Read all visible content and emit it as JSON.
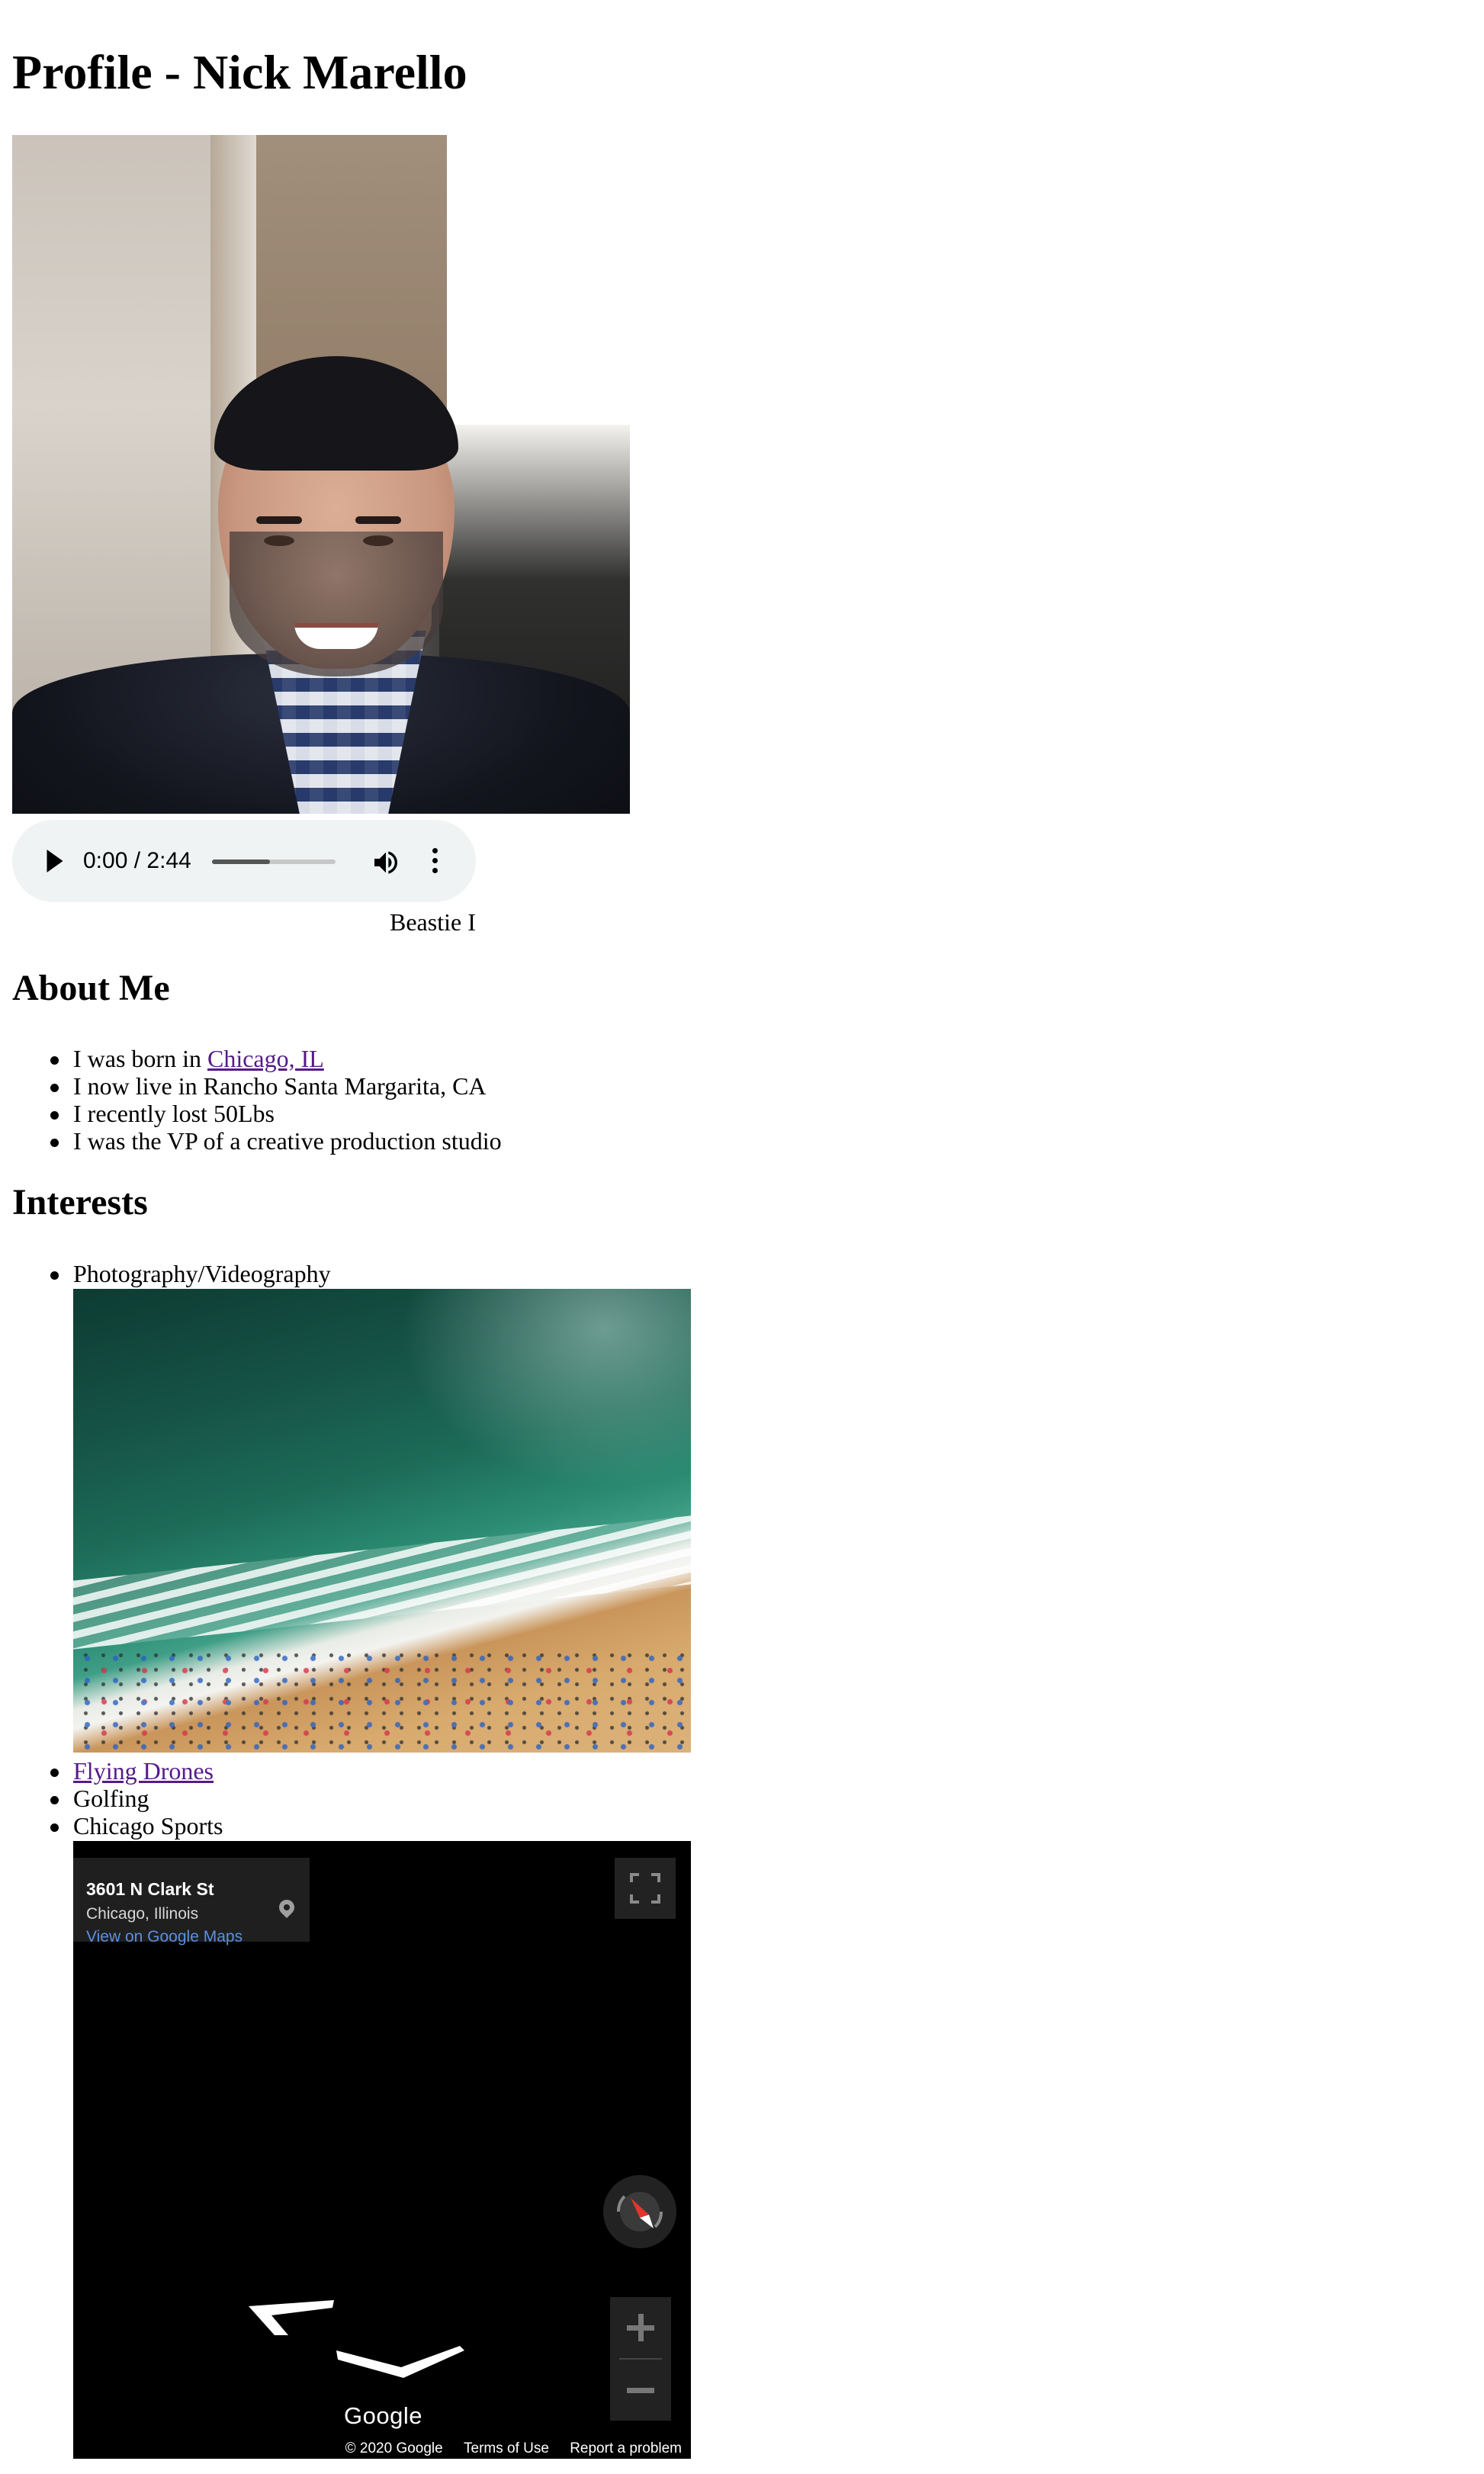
{
  "page": {
    "title": "Profile - Nick Marello"
  },
  "portrait": {
    "alt": "Nick Marello"
  },
  "audio": {
    "time": "0:00 / 2:44",
    "progress_fraction": 0.47,
    "caption": "Beastie I"
  },
  "about": {
    "heading": "About Me",
    "items": [
      {
        "prefix": "I was born in ",
        "link": "Chicago, IL"
      },
      {
        "text": "I now live in Rancho Santa Margarita, CA"
      },
      {
        "text": "I recently lost 50Lbs"
      },
      {
        "text": "I was the VP of a creative production studio"
      }
    ]
  },
  "interests": {
    "heading": "Interests",
    "items": [
      {
        "text": "Photography/Videography"
      },
      {
        "link": "Flying Drones"
      },
      {
        "text": "Golfing"
      },
      {
        "text": "Chicago Sports"
      }
    ]
  },
  "streetview": {
    "address": "3601 N Clark St",
    "city": "Chicago, Illinois",
    "maps_link": "View on Google Maps",
    "logo": "Google",
    "copyright": "© 2020 Google",
    "terms": "Terms of Use",
    "report": "Report a problem"
  },
  "icons": {
    "play": "play-icon",
    "volume": "volume-icon",
    "more": "more-vertical-icon",
    "pin": "map-pin-icon",
    "fullscreen": "fullscreen-icon",
    "compass": "compass-icon",
    "zoom_in": "plus-icon",
    "zoom_out": "minus-icon"
  },
  "colors": {
    "link_visited": "#551a8b",
    "maps_link": "#5b8fe0",
    "audio_bg": "#f0f3f4"
  }
}
